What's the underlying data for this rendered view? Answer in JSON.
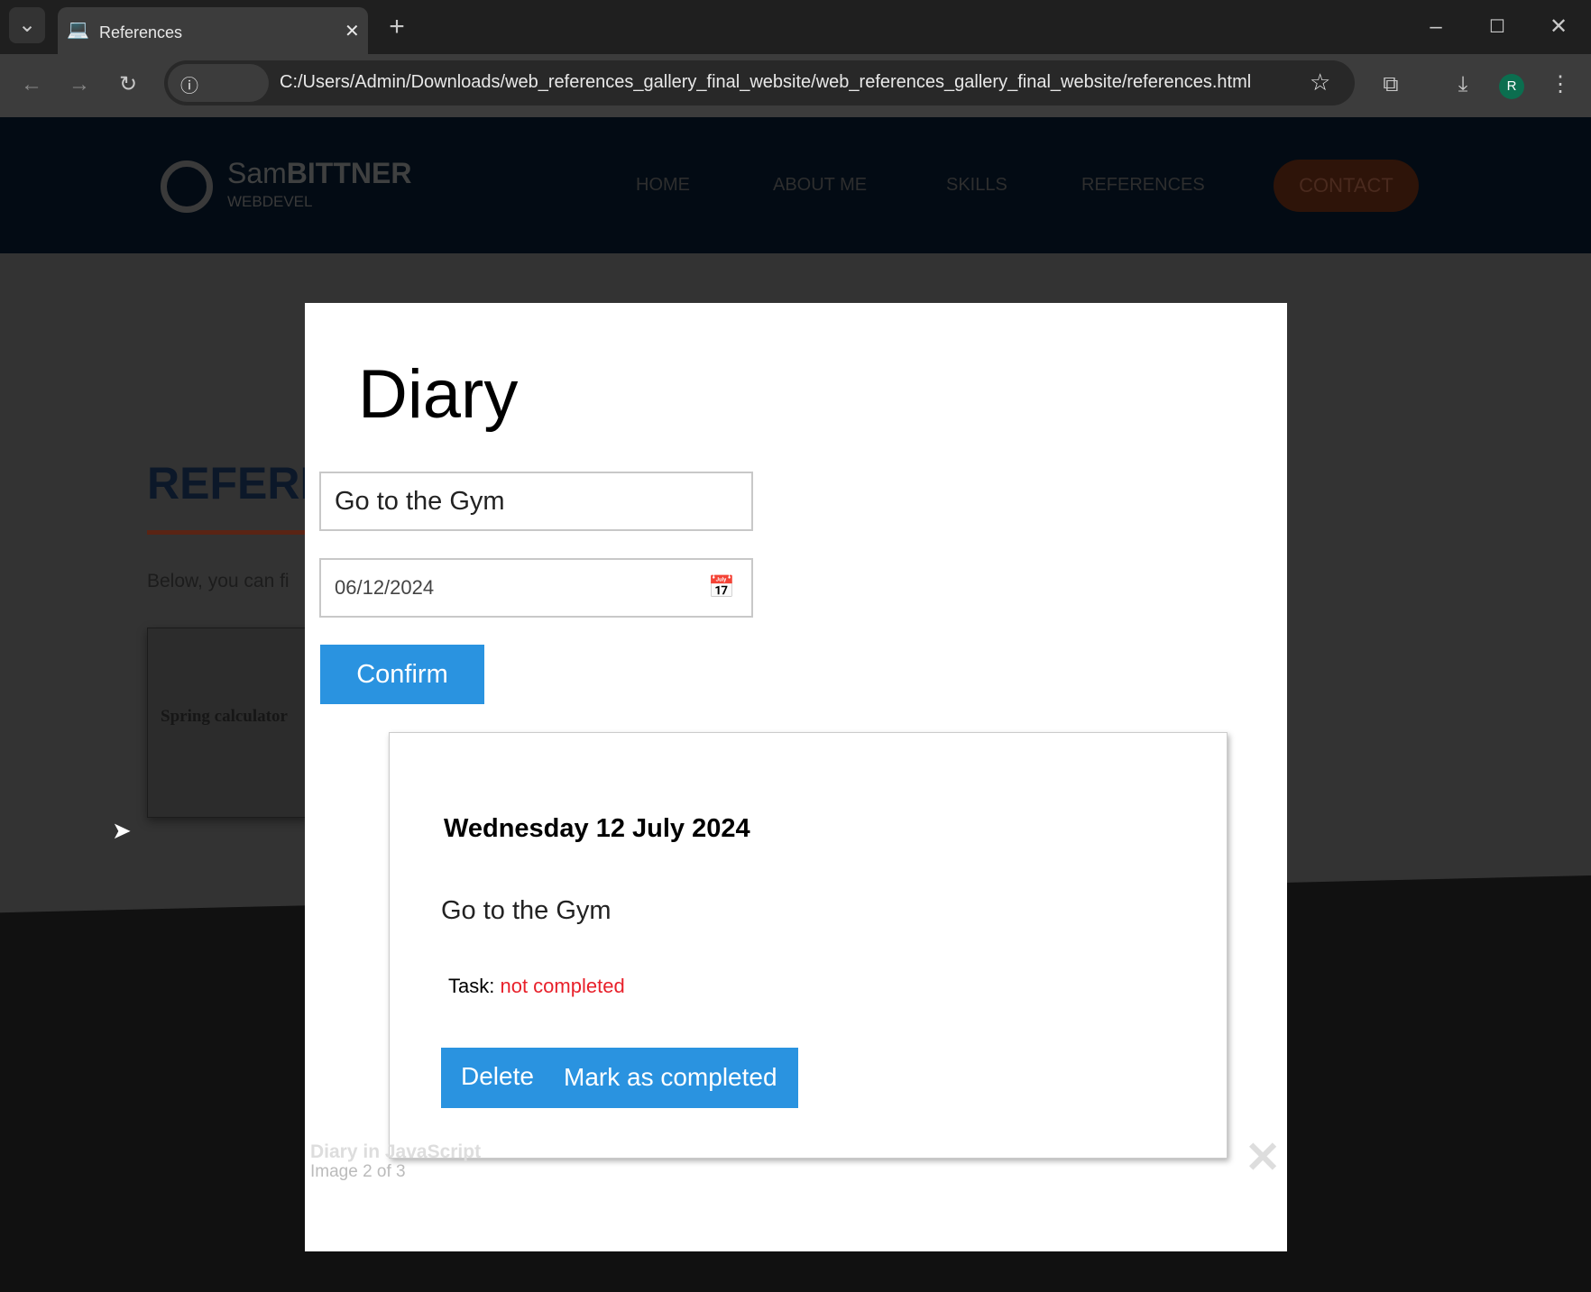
{
  "browser": {
    "tab_title": "References",
    "url": "C:/Users/Admin/Downloads/web_references_gallery_final_website/web_references_gallery_final_website/references.html",
    "profile_initial": "R"
  },
  "site": {
    "logo_light": "Sam",
    "logo_bold": "BITTNER",
    "logo_sub": "WEBDEVEL",
    "nav": [
      "HOME",
      "ABOUT ME",
      "SKILLS",
      "REFERENCES"
    ],
    "contact": "CONTACT",
    "heading": "REFERE",
    "intro": "Below, you can fi",
    "thumb_title": "Spring calculator"
  },
  "diary": {
    "title": "Diary",
    "task_input": "Go to the Gym",
    "date_input": "06/12/2024",
    "confirm": "Confirm",
    "entry": {
      "date": "Wednesday 12 July 2024",
      "text": "Go to the Gym",
      "task_label": "Task:",
      "status": "not completed",
      "delete": "Delete",
      "mark": "Mark as completed"
    }
  },
  "lightbox": {
    "caption": "Diary in JavaScript",
    "counter": "Image 2 of 3",
    "close_icon": "close-icon"
  },
  "colors": {
    "accent": "#2a93e0",
    "status_red": "#e8202a"
  }
}
